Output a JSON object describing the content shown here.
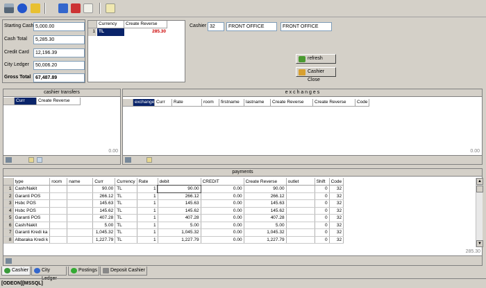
{
  "cash_summary": {
    "starting_cash": {
      "label": "Starting Cash",
      "value": "5,000.00"
    },
    "cash_total": {
      "label": "Cash Total",
      "value": "5,285.30"
    },
    "credit_card": {
      "label": "Credit Card",
      "value": "12,196.39"
    },
    "city_ledger": {
      "label": "City Ledger",
      "value": "50,006.20"
    },
    "gross_total": {
      "label": "Gross Total",
      "value": "67,487.89"
    }
  },
  "currency_grid": {
    "headers": [
      "Currency",
      "Create Reverse"
    ],
    "row_number": "1",
    "currency": "TL",
    "amount": "285.30"
  },
  "cashier_info": {
    "label": "Cashier",
    "id": "32",
    "name1": "FRONT OFFICE",
    "name2": "FRONT OFFICE"
  },
  "buttons": {
    "refresh": "refresh",
    "cashier_close": "Cashier Close"
  },
  "cashier_transfers": {
    "title": "cashier transfers",
    "headers": [
      "Curr",
      "Create Reverse"
    ],
    "total": "0.00"
  },
  "exchanges": {
    "title": "e x c h a n g e s",
    "headers": [
      "exchange",
      "Curr",
      "Rate",
      "room",
      "firstname",
      "lastname",
      "Create Reverse",
      "Create Reverse",
      "Code"
    ],
    "total": "0.00"
  },
  "payments": {
    "title": "payments",
    "headers": [
      "type",
      "room",
      "name",
      "Curr",
      "Currency",
      "Rate",
      "debit",
      "CREDIT",
      "Create Reverse",
      "outlet",
      "Shift",
      "Code"
    ],
    "rows": [
      {
        "n": "1",
        "type": "Cash/Nakit",
        "room": "",
        "name": "",
        "curr": "90.00",
        "currency": "TL",
        "rate": "1",
        "debit": "90.00",
        "credit": "0.00",
        "reverse": "90.00",
        "outlet": "",
        "shift": "0",
        "code": "32"
      },
      {
        "n": "2",
        "type": "Garanti POS",
        "room": "",
        "name": "",
        "curr": "266.12",
        "currency": "TL",
        "rate": "1",
        "debit": "266.12",
        "credit": "0.00",
        "reverse": "266.12",
        "outlet": "",
        "shift": "0",
        "code": "32"
      },
      {
        "n": "3",
        "type": "Hsbc POS",
        "room": "",
        "name": "",
        "curr": "145.63",
        "currency": "TL",
        "rate": "1",
        "debit": "145.63",
        "credit": "0.00",
        "reverse": "145.63",
        "outlet": "",
        "shift": "0",
        "code": "32"
      },
      {
        "n": "4",
        "type": "Hsbc POS",
        "room": "",
        "name": "",
        "curr": "145.62",
        "currency": "TL",
        "rate": "1",
        "debit": "145.62",
        "credit": "0.00",
        "reverse": "145.62",
        "outlet": "",
        "shift": "0",
        "code": "32"
      },
      {
        "n": "5",
        "type": "Garanti POS",
        "room": "",
        "name": "",
        "curr": "407.28",
        "currency": "TL",
        "rate": "1",
        "debit": "407.28",
        "credit": "0.00",
        "reverse": "407.28",
        "outlet": "",
        "shift": "0",
        "code": "32"
      },
      {
        "n": "6",
        "type": "Cash/Nakit",
        "room": "",
        "name": "",
        "curr": "5.00",
        "currency": "TL",
        "rate": "1",
        "debit": "5.00",
        "credit": "0.00",
        "reverse": "5.00",
        "outlet": "",
        "shift": "0",
        "code": "32"
      },
      {
        "n": "7",
        "type": "Garanti Kredi ka",
        "room": "",
        "name": "",
        "curr": "1,045.32",
        "currency": "TL",
        "rate": "1",
        "debit": "1,045.32",
        "credit": "0.00",
        "reverse": "1,045.32",
        "outlet": "",
        "shift": "0",
        "code": "32"
      },
      {
        "n": "8",
        "type": "Albaraka Kredi k",
        "room": "",
        "name": "",
        "curr": "1,227.79",
        "currency": "TL",
        "rate": "1",
        "debit": "1,227.79",
        "credit": "0.00",
        "reverse": "1,227.79",
        "outlet": "",
        "shift": "0",
        "code": "32"
      }
    ],
    "total": "285.30"
  },
  "tabs": [
    "Cashier",
    "City Ledger",
    "Postings",
    "Deposit Cashier"
  ],
  "status": "[ODEON][MSSQL]",
  "colors": {
    "selected_header": "#0a246a",
    "negative_amount": "#cc0000"
  }
}
